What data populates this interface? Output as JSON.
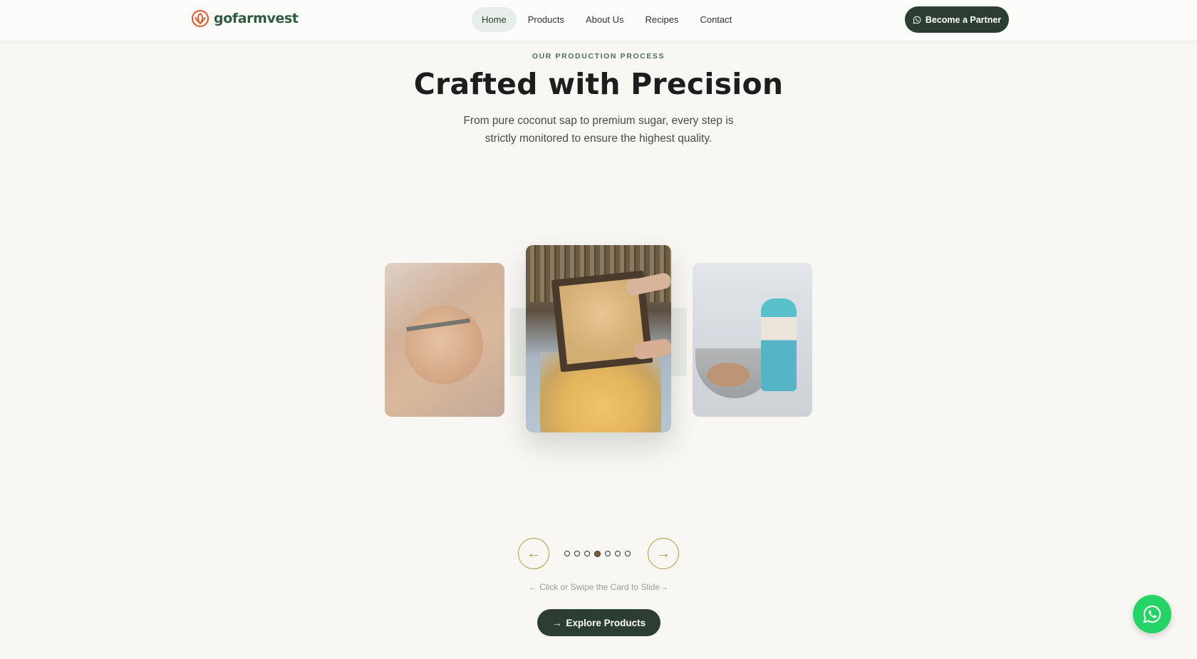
{
  "brand": {
    "name": "gofarmvest"
  },
  "nav": {
    "items": [
      {
        "label": "Home",
        "active": true
      },
      {
        "label": "Products",
        "active": false
      },
      {
        "label": "About Us",
        "active": false
      },
      {
        "label": "Recipes",
        "active": false
      },
      {
        "label": "Contact",
        "active": false
      }
    ],
    "cta_label": "Become a Partner",
    "cta_icon": "whatsapp-icon"
  },
  "hero": {
    "eyebrow": "OUR PRODUCTION PROCESS",
    "title": "Crafted with Precision",
    "subtitle": "From pure coconut sap to premium sugar, every step is strictly monitored to ensure the highest quality."
  },
  "carousel": {
    "slide_count": 7,
    "active_index": 3,
    "prev_icon": "arrow-left-icon",
    "next_icon": "arrow-right-icon",
    "hint": "← Click or Swipe the Card to Slide→"
  },
  "explore": {
    "label": "Explore Products",
    "icon": "arrow-right-icon"
  },
  "colors": {
    "brand_green": "#2f5a3e",
    "button_dark": "#2c3e31",
    "accent_gold": "#b8963e",
    "logo_orange": "#e0532c",
    "whatsapp_green": "#25d366",
    "background": "#f8f7f3"
  }
}
